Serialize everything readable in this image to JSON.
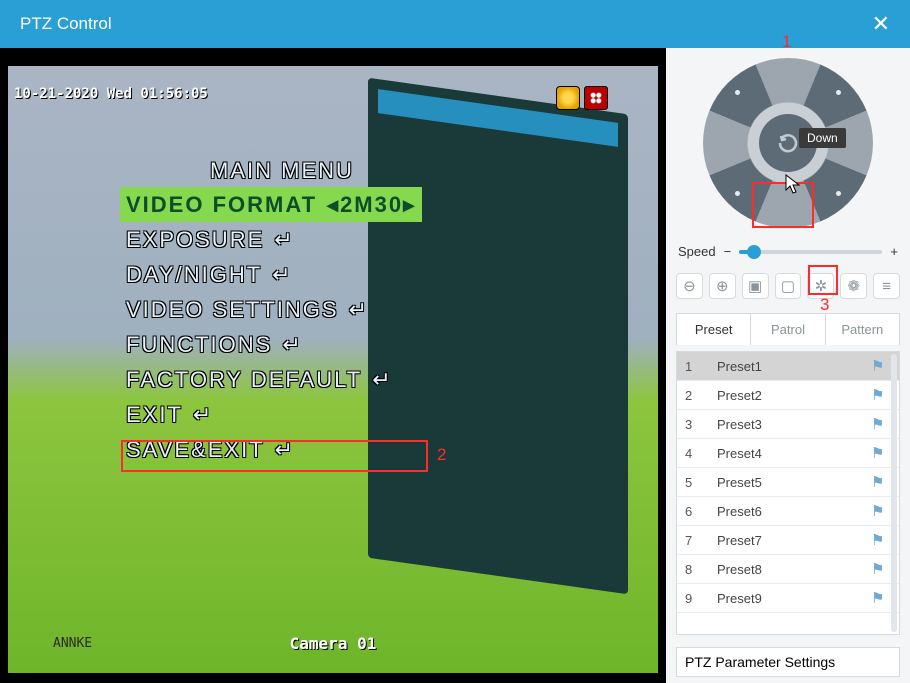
{
  "title": "PTZ Control",
  "video": {
    "timestamp": "10-21-2020 Wed 01:56:05",
    "camera_name": "Camera 01",
    "brand": "ANNKE",
    "osd": {
      "header": "MAIN MENU",
      "rows": [
        {
          "label": "VIDEO FORMAT",
          "value": "2M30",
          "selected": true,
          "arrows": true
        },
        {
          "label": "EXPOSURE",
          "ret": true
        },
        {
          "label": "DAY/NIGHT",
          "ret": true
        },
        {
          "label": "VIDEO SETTINGS",
          "ret": true
        },
        {
          "label": "FUNCTIONS",
          "ret": true
        },
        {
          "label": "FACTORY DEFAULT",
          "ret": true
        },
        {
          "label": "EXIT",
          "ret": true
        },
        {
          "label": "SAVE&EXIT",
          "ret": true
        }
      ]
    }
  },
  "annotations": {
    "a1": "1",
    "a2": "2",
    "a3": "3"
  },
  "joystick": {
    "tooltip": "Down"
  },
  "speed": {
    "label": "Speed",
    "minus": "−",
    "plus": "+"
  },
  "toolbar_icons": [
    "zoom-out",
    "zoom-in",
    "focus-near",
    "focus-far",
    "iris-open",
    "iris-close",
    "more"
  ],
  "toolbar_glyphs": [
    "⊖",
    "⊕",
    "▣",
    "▢",
    "✲",
    "❁",
    "≡"
  ],
  "tabs": {
    "preset": "Preset",
    "patrol": "Patrol",
    "pattern": "Pattern",
    "active": "preset"
  },
  "presets": [
    {
      "n": "1",
      "name": "Preset1"
    },
    {
      "n": "2",
      "name": "Preset2"
    },
    {
      "n": "3",
      "name": "Preset3"
    },
    {
      "n": "4",
      "name": "Preset4"
    },
    {
      "n": "5",
      "name": "Preset5"
    },
    {
      "n": "6",
      "name": "Preset6"
    },
    {
      "n": "7",
      "name": "Preset7"
    },
    {
      "n": "8",
      "name": "Preset8"
    },
    {
      "n": "9",
      "name": "Preset9"
    }
  ],
  "footer_btn": "PTZ Parameter Settings"
}
